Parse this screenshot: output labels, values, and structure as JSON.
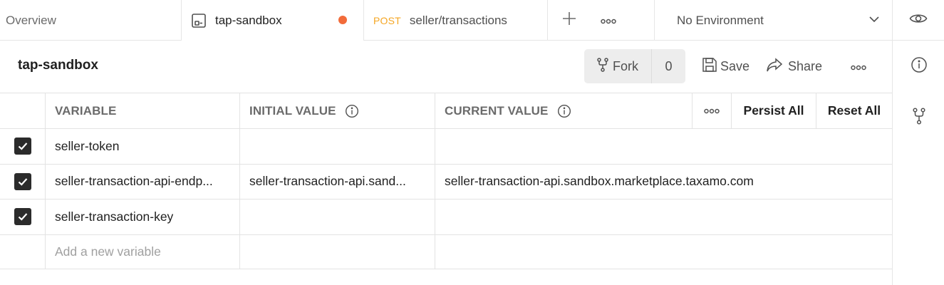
{
  "tabs": {
    "overview": "Overview",
    "collection": "tap-sandbox",
    "request_method": "POST",
    "request_name": "seller/transactions"
  },
  "environment": {
    "selected": "No Environment"
  },
  "header": {
    "title": "tap-sandbox",
    "fork_label": "Fork",
    "fork_count": "0",
    "save_label": "Save",
    "share_label": "Share"
  },
  "table": {
    "columns": [
      "VARIABLE",
      "INITIAL VALUE",
      "CURRENT VALUE"
    ],
    "persist_all": "Persist All",
    "reset_all": "Reset All",
    "rows": [
      {
        "checked": true,
        "variable": "seller-token",
        "initial": "",
        "current": ""
      },
      {
        "checked": true,
        "variable": "seller-transaction-api-endp...",
        "initial": "seller-transaction-api.sand...",
        "current": "seller-transaction-api.sandbox.marketplace.taxamo.com"
      },
      {
        "checked": true,
        "variable": "seller-transaction-key",
        "initial": "",
        "current": ""
      }
    ],
    "add_placeholder": "Add a new variable"
  },
  "colors": {
    "accent_dot": "#f26b3a",
    "method_post": "#f5a623",
    "checkbox": "#2b2b2b"
  }
}
